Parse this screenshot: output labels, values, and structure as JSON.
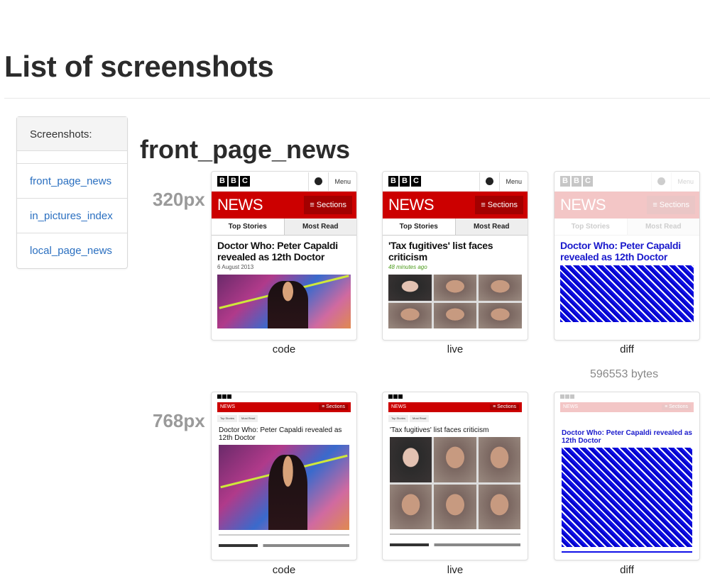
{
  "page": {
    "title": "List of screenshots"
  },
  "sidebar": {
    "heading": "Screenshots:",
    "items": [
      {
        "label": "front_page_news"
      },
      {
        "label": "in_pictures_index"
      },
      {
        "label": "local_page_news"
      }
    ]
  },
  "section": {
    "title": "front_page_news",
    "rows": [
      {
        "width_label": "320px",
        "captions": {
          "code": "code",
          "live": "live",
          "diff": "diff"
        },
        "bytes": "596553 bytes",
        "mock": {
          "bbc": [
            "B",
            "B",
            "C"
          ],
          "menu": "Menu",
          "news": "NEWS",
          "sections": "≡ Sections",
          "tab_top": "Top Stories",
          "tab_most": "Most Read",
          "code_headline": "Doctor Who: Peter Capaldi revealed as 12th Doctor",
          "code_meta": "6 August 2013",
          "live_headline": "'Tax fugitives' list faces criticism",
          "live_meta": "48 minutes ago",
          "diff_headline": "Doctor Who: Peter Capaldi revealed as 12th Doctor"
        }
      },
      {
        "width_label": "768px",
        "captions": {
          "code": "code",
          "live": "live",
          "diff": "diff"
        },
        "mock": {
          "news": "NEWS",
          "sections": "≡ Sections",
          "tab_top": "Top Stories",
          "tab_most": "Most Read",
          "code_headline": "Doctor Who: Peter Capaldi revealed as 12th Doctor",
          "live_headline": "'Tax fugitives' list faces criticism",
          "diff_headline": "Doctor Who: Peter Capaldi revealed as 12th Doctor"
        }
      }
    ]
  },
  "colors": {
    "bbc_red": "#cc0000",
    "link": "#2a6fc0",
    "diff_blue": "#1010e8"
  }
}
